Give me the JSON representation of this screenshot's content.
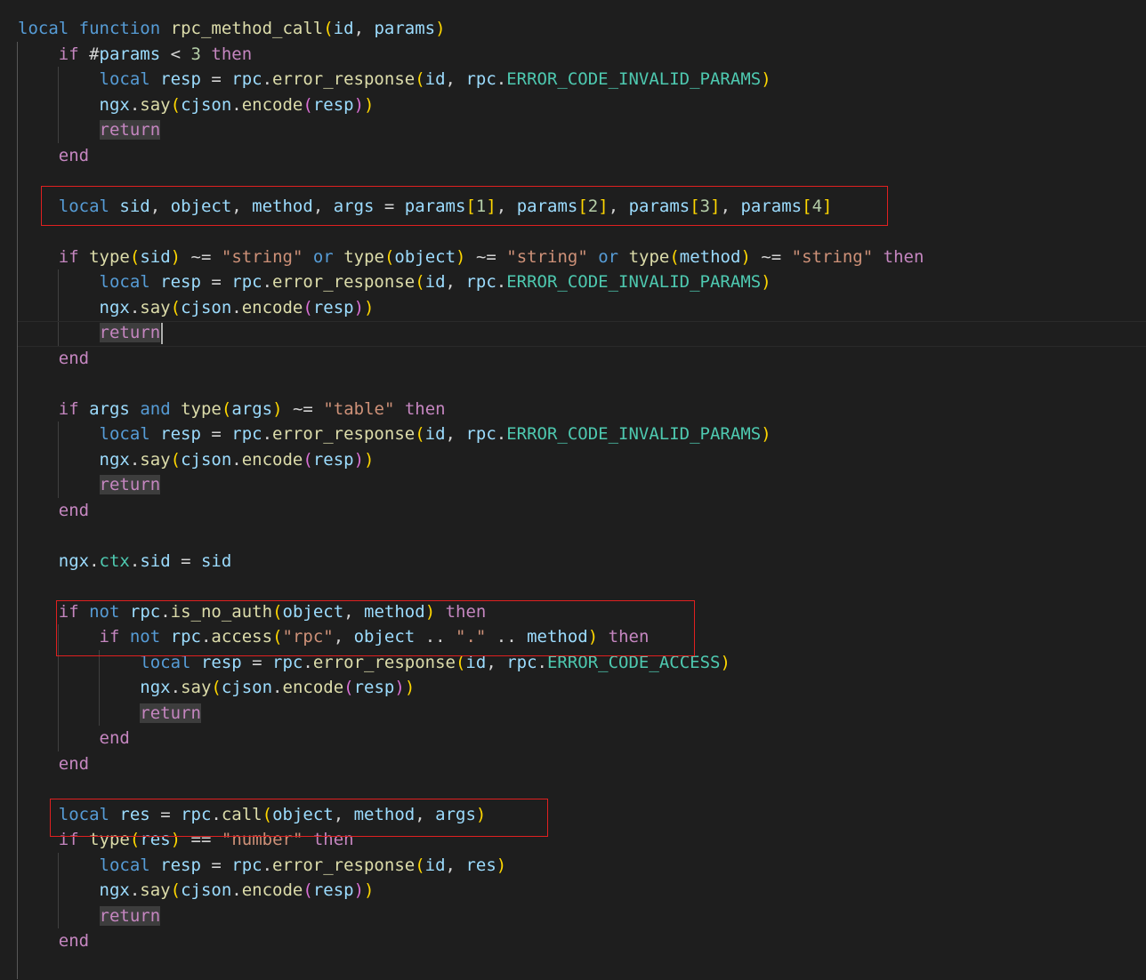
{
  "editor": {
    "language": "lua",
    "theme": "dark",
    "highlight_color": "#e02020",
    "lines": [
      [
        [
          "kw",
          "local"
        ],
        [
          "op",
          " "
        ],
        [
          "kw",
          "function"
        ],
        [
          "op",
          " "
        ],
        [
          "fn",
          "rpc_method_call"
        ],
        [
          "b1",
          "("
        ],
        [
          "var",
          "id"
        ],
        [
          "op",
          ", "
        ],
        [
          "var",
          "params"
        ],
        [
          "b1",
          ")"
        ]
      ],
      [
        [
          "op",
          "    "
        ],
        [
          "ctl",
          "if"
        ],
        [
          "op",
          " #"
        ],
        [
          "var",
          "params"
        ],
        [
          "op",
          " < "
        ],
        [
          "num",
          "3"
        ],
        [
          "op",
          " "
        ],
        [
          "ctl",
          "then"
        ]
      ],
      [
        [
          "op",
          "        "
        ],
        [
          "kw",
          "local"
        ],
        [
          "op",
          " "
        ],
        [
          "var",
          "resp"
        ],
        [
          "op",
          " = "
        ],
        [
          "var",
          "rpc"
        ],
        [
          "op",
          "."
        ],
        [
          "fn",
          "error_response"
        ],
        [
          "b1",
          "("
        ],
        [
          "var",
          "id"
        ],
        [
          "op",
          ", "
        ],
        [
          "var",
          "rpc"
        ],
        [
          "op",
          "."
        ],
        [
          "cst",
          "ERROR_CODE_INVALID_PARAMS"
        ],
        [
          "b1",
          ")"
        ]
      ],
      [
        [
          "op",
          "        "
        ],
        [
          "var",
          "ngx"
        ],
        [
          "op",
          "."
        ],
        [
          "fn",
          "say"
        ],
        [
          "b1",
          "("
        ],
        [
          "var",
          "cjson"
        ],
        [
          "op",
          "."
        ],
        [
          "fn",
          "encode"
        ],
        [
          "b2",
          "("
        ],
        [
          "var",
          "resp"
        ],
        [
          "b2",
          ")"
        ],
        [
          "b1",
          ")"
        ]
      ],
      [
        [
          "op",
          "        "
        ],
        [
          "ret",
          "return"
        ]
      ],
      [
        [
          "op",
          "    "
        ],
        [
          "ctl",
          "end"
        ]
      ],
      [],
      [
        [
          "op",
          "    "
        ],
        [
          "kw",
          "local"
        ],
        [
          "op",
          " "
        ],
        [
          "var",
          "sid"
        ],
        [
          "op",
          ", "
        ],
        [
          "var",
          "object"
        ],
        [
          "op",
          ", "
        ],
        [
          "var",
          "method"
        ],
        [
          "op",
          ", "
        ],
        [
          "var",
          "args"
        ],
        [
          "op",
          " = "
        ],
        [
          "var",
          "params"
        ],
        [
          "b1",
          "["
        ],
        [
          "num",
          "1"
        ],
        [
          "b1",
          "]"
        ],
        [
          "op",
          ", "
        ],
        [
          "var",
          "params"
        ],
        [
          "b1",
          "["
        ],
        [
          "num",
          "2"
        ],
        [
          "b1",
          "]"
        ],
        [
          "op",
          ", "
        ],
        [
          "var",
          "params"
        ],
        [
          "b1",
          "["
        ],
        [
          "num",
          "3"
        ],
        [
          "b1",
          "]"
        ],
        [
          "op",
          ", "
        ],
        [
          "var",
          "params"
        ],
        [
          "b1",
          "["
        ],
        [
          "num",
          "4"
        ],
        [
          "b1",
          "]"
        ]
      ],
      [],
      [
        [
          "op",
          "    "
        ],
        [
          "ctl",
          "if"
        ],
        [
          "op",
          " "
        ],
        [
          "fn",
          "type"
        ],
        [
          "b1",
          "("
        ],
        [
          "var",
          "sid"
        ],
        [
          "b1",
          ")"
        ],
        [
          "op",
          " ~= "
        ],
        [
          "str",
          "\"string\""
        ],
        [
          "op",
          " "
        ],
        [
          "kw",
          "or"
        ],
        [
          "op",
          " "
        ],
        [
          "fn",
          "type"
        ],
        [
          "b1",
          "("
        ],
        [
          "var",
          "object"
        ],
        [
          "b1",
          ")"
        ],
        [
          "op",
          " ~= "
        ],
        [
          "str",
          "\"string\""
        ],
        [
          "op",
          " "
        ],
        [
          "kw",
          "or"
        ],
        [
          "op",
          " "
        ],
        [
          "fn",
          "type"
        ],
        [
          "b1",
          "("
        ],
        [
          "var",
          "method"
        ],
        [
          "b1",
          ")"
        ],
        [
          "op",
          " ~= "
        ],
        [
          "str",
          "\"string\""
        ],
        [
          "op",
          " "
        ],
        [
          "ctl",
          "then"
        ]
      ],
      [
        [
          "op",
          "        "
        ],
        [
          "kw",
          "local"
        ],
        [
          "op",
          " "
        ],
        [
          "var",
          "resp"
        ],
        [
          "op",
          " = "
        ],
        [
          "var",
          "rpc"
        ],
        [
          "op",
          "."
        ],
        [
          "fn",
          "error_response"
        ],
        [
          "b1",
          "("
        ],
        [
          "var",
          "id"
        ],
        [
          "op",
          ", "
        ],
        [
          "var",
          "rpc"
        ],
        [
          "op",
          "."
        ],
        [
          "cst",
          "ERROR_CODE_INVALID_PARAMS"
        ],
        [
          "b1",
          ")"
        ]
      ],
      [
        [
          "op",
          "        "
        ],
        [
          "var",
          "ngx"
        ],
        [
          "op",
          "."
        ],
        [
          "fn",
          "say"
        ],
        [
          "b1",
          "("
        ],
        [
          "var",
          "cjson"
        ],
        [
          "op",
          "."
        ],
        [
          "fn",
          "encode"
        ],
        [
          "b2",
          "("
        ],
        [
          "var",
          "resp"
        ],
        [
          "b2",
          ")"
        ],
        [
          "b1",
          ")"
        ]
      ],
      [
        [
          "op",
          "        "
        ],
        [
          "ret",
          "return"
        ]
      ],
      [
        [
          "op",
          "    "
        ],
        [
          "ctl",
          "end"
        ]
      ],
      [],
      [
        [
          "op",
          "    "
        ],
        [
          "ctl",
          "if"
        ],
        [
          "op",
          " "
        ],
        [
          "var",
          "args"
        ],
        [
          "op",
          " "
        ],
        [
          "kw",
          "and"
        ],
        [
          "op",
          " "
        ],
        [
          "fn",
          "type"
        ],
        [
          "b1",
          "("
        ],
        [
          "var",
          "args"
        ],
        [
          "b1",
          ")"
        ],
        [
          "op",
          " ~= "
        ],
        [
          "str",
          "\"table\""
        ],
        [
          "op",
          " "
        ],
        [
          "ctl",
          "then"
        ]
      ],
      [
        [
          "op",
          "        "
        ],
        [
          "kw",
          "local"
        ],
        [
          "op",
          " "
        ],
        [
          "var",
          "resp"
        ],
        [
          "op",
          " = "
        ],
        [
          "var",
          "rpc"
        ],
        [
          "op",
          "."
        ],
        [
          "fn",
          "error_response"
        ],
        [
          "b1",
          "("
        ],
        [
          "var",
          "id"
        ],
        [
          "op",
          ", "
        ],
        [
          "var",
          "rpc"
        ],
        [
          "op",
          "."
        ],
        [
          "cst",
          "ERROR_CODE_INVALID_PARAMS"
        ],
        [
          "b1",
          ")"
        ]
      ],
      [
        [
          "op",
          "        "
        ],
        [
          "var",
          "ngx"
        ],
        [
          "op",
          "."
        ],
        [
          "fn",
          "say"
        ],
        [
          "b1",
          "("
        ],
        [
          "var",
          "cjson"
        ],
        [
          "op",
          "."
        ],
        [
          "fn",
          "encode"
        ],
        [
          "b2",
          "("
        ],
        [
          "var",
          "resp"
        ],
        [
          "b2",
          ")"
        ],
        [
          "b1",
          ")"
        ]
      ],
      [
        [
          "op",
          "        "
        ],
        [
          "ret",
          "return"
        ]
      ],
      [
        [
          "op",
          "    "
        ],
        [
          "ctl",
          "end"
        ]
      ],
      [],
      [
        [
          "op",
          "    "
        ],
        [
          "var",
          "ngx"
        ],
        [
          "op",
          "."
        ],
        [
          "cst",
          "ctx"
        ],
        [
          "op",
          "."
        ],
        [
          "var",
          "sid"
        ],
        [
          "op",
          " = "
        ],
        [
          "var",
          "sid"
        ]
      ],
      [],
      [
        [
          "op",
          "    "
        ],
        [
          "ctl",
          "if"
        ],
        [
          "op",
          " "
        ],
        [
          "kw",
          "not"
        ],
        [
          "op",
          " "
        ],
        [
          "var",
          "rpc"
        ],
        [
          "op",
          "."
        ],
        [
          "fn",
          "is_no_auth"
        ],
        [
          "b1",
          "("
        ],
        [
          "var",
          "object"
        ],
        [
          "op",
          ", "
        ],
        [
          "var",
          "method"
        ],
        [
          "b1",
          ")"
        ],
        [
          "op",
          " "
        ],
        [
          "ctl",
          "then"
        ]
      ],
      [
        [
          "op",
          "        "
        ],
        [
          "ctl",
          "if"
        ],
        [
          "op",
          " "
        ],
        [
          "kw",
          "not"
        ],
        [
          "op",
          " "
        ],
        [
          "var",
          "rpc"
        ],
        [
          "op",
          "."
        ],
        [
          "fn",
          "access"
        ],
        [
          "b1",
          "("
        ],
        [
          "str",
          "\"rpc\""
        ],
        [
          "op",
          ", "
        ],
        [
          "var",
          "object"
        ],
        [
          "op",
          " .. "
        ],
        [
          "str",
          "\".\""
        ],
        [
          "op",
          " .. "
        ],
        [
          "var",
          "method"
        ],
        [
          "b1",
          ")"
        ],
        [
          "op",
          " "
        ],
        [
          "ctl",
          "then"
        ]
      ],
      [
        [
          "op",
          "            "
        ],
        [
          "kw",
          "local"
        ],
        [
          "op",
          " "
        ],
        [
          "var",
          "resp"
        ],
        [
          "op",
          " = "
        ],
        [
          "var",
          "rpc"
        ],
        [
          "op",
          "."
        ],
        [
          "fn",
          "error_response"
        ],
        [
          "b1",
          "("
        ],
        [
          "var",
          "id"
        ],
        [
          "op",
          ", "
        ],
        [
          "var",
          "rpc"
        ],
        [
          "op",
          "."
        ],
        [
          "cst",
          "ERROR_CODE_ACCESS"
        ],
        [
          "b1",
          ")"
        ]
      ],
      [
        [
          "op",
          "            "
        ],
        [
          "var",
          "ngx"
        ],
        [
          "op",
          "."
        ],
        [
          "fn",
          "say"
        ],
        [
          "b1",
          "("
        ],
        [
          "var",
          "cjson"
        ],
        [
          "op",
          "."
        ],
        [
          "fn",
          "encode"
        ],
        [
          "b2",
          "("
        ],
        [
          "var",
          "resp"
        ],
        [
          "b2",
          ")"
        ],
        [
          "b1",
          ")"
        ]
      ],
      [
        [
          "op",
          "            "
        ],
        [
          "ret",
          "return"
        ]
      ],
      [
        [
          "op",
          "        "
        ],
        [
          "ctl",
          "end"
        ]
      ],
      [
        [
          "op",
          "    "
        ],
        [
          "ctl",
          "end"
        ]
      ],
      [],
      [
        [
          "op",
          "    "
        ],
        [
          "kw",
          "local"
        ],
        [
          "op",
          " "
        ],
        [
          "var",
          "res"
        ],
        [
          "op",
          " = "
        ],
        [
          "var",
          "rpc"
        ],
        [
          "op",
          "."
        ],
        [
          "fn",
          "call"
        ],
        [
          "b1",
          "("
        ],
        [
          "var",
          "object"
        ],
        [
          "op",
          ", "
        ],
        [
          "var",
          "method"
        ],
        [
          "op",
          ", "
        ],
        [
          "var",
          "args"
        ],
        [
          "b1",
          ")"
        ]
      ],
      [
        [
          "op",
          "    "
        ],
        [
          "ctl",
          "if"
        ],
        [
          "op",
          " "
        ],
        [
          "fn",
          "type"
        ],
        [
          "b1",
          "("
        ],
        [
          "var",
          "res"
        ],
        [
          "b1",
          ")"
        ],
        [
          "op",
          " == "
        ],
        [
          "str",
          "\"number\""
        ],
        [
          "op",
          " "
        ],
        [
          "ctl",
          "then"
        ]
      ],
      [
        [
          "op",
          "        "
        ],
        [
          "kw",
          "local"
        ],
        [
          "op",
          " "
        ],
        [
          "var",
          "resp"
        ],
        [
          "op",
          " = "
        ],
        [
          "var",
          "rpc"
        ],
        [
          "op",
          "."
        ],
        [
          "fn",
          "error_response"
        ],
        [
          "b1",
          "("
        ],
        [
          "var",
          "id"
        ],
        [
          "op",
          ", "
        ],
        [
          "var",
          "res"
        ],
        [
          "b1",
          ")"
        ]
      ],
      [
        [
          "op",
          "        "
        ],
        [
          "var",
          "ngx"
        ],
        [
          "op",
          "."
        ],
        [
          "fn",
          "say"
        ],
        [
          "b1",
          "("
        ],
        [
          "var",
          "cjson"
        ],
        [
          "op",
          "."
        ],
        [
          "fn",
          "encode"
        ],
        [
          "b2",
          "("
        ],
        [
          "var",
          "resp"
        ],
        [
          "b2",
          ")"
        ],
        [
          "b1",
          ")"
        ]
      ],
      [
        [
          "op",
          "        "
        ],
        [
          "ret",
          "return"
        ]
      ],
      [
        [
          "op",
          "    "
        ],
        [
          "ctl",
          "end"
        ]
      ],
      [],
      []
    ]
  }
}
